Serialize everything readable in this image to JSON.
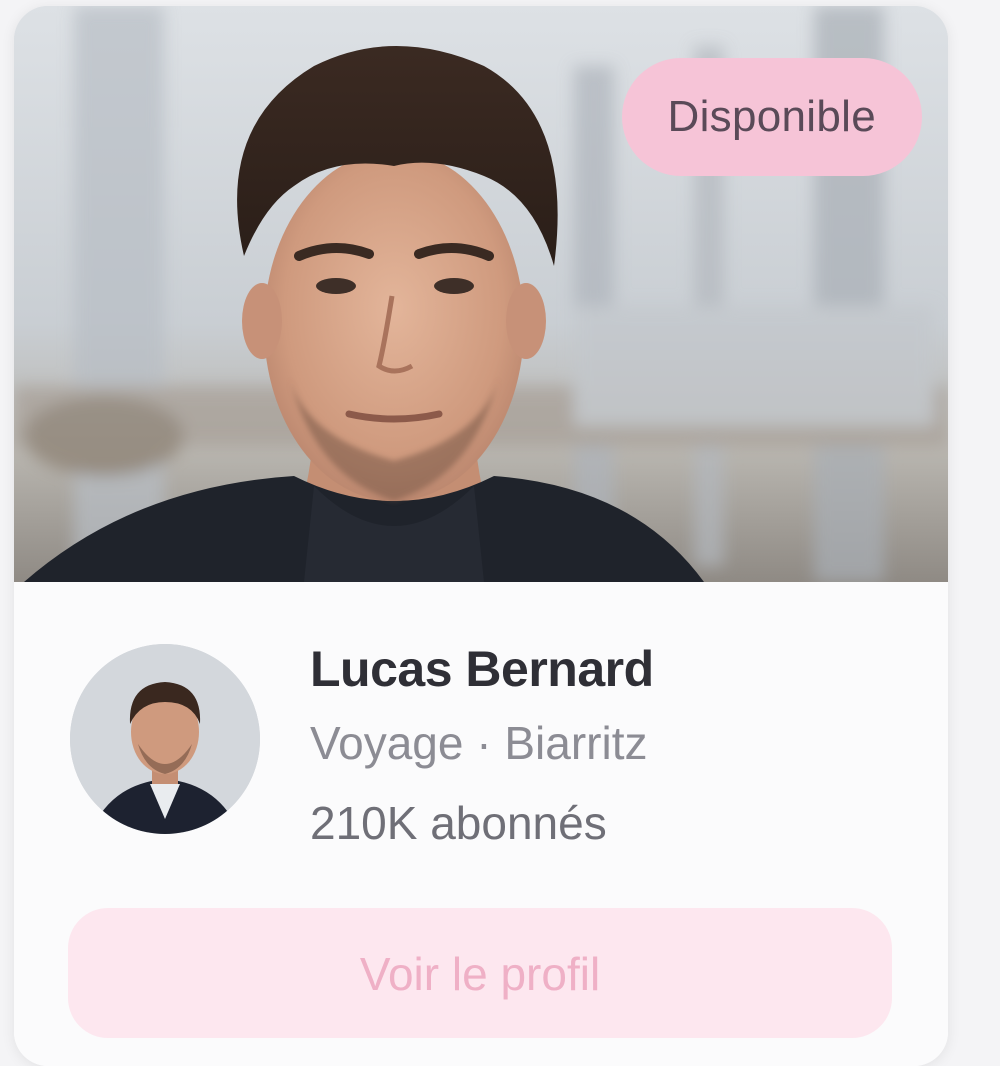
{
  "profile_card": {
    "badge": "Disponible",
    "name": "Lucas Bernard",
    "meta": "Voyage · Biarritz",
    "followers": "210K abonnés",
    "cta_label": "Voir le profil"
  },
  "colors": {
    "badge_bg": "#f6c4d7",
    "cta_bg": "#fde7ef",
    "cta_text": "#efb0c6",
    "name_text": "#2f2f36"
  },
  "images": {
    "cover": "portrait-photo",
    "avatar": "avatar-photo"
  }
}
